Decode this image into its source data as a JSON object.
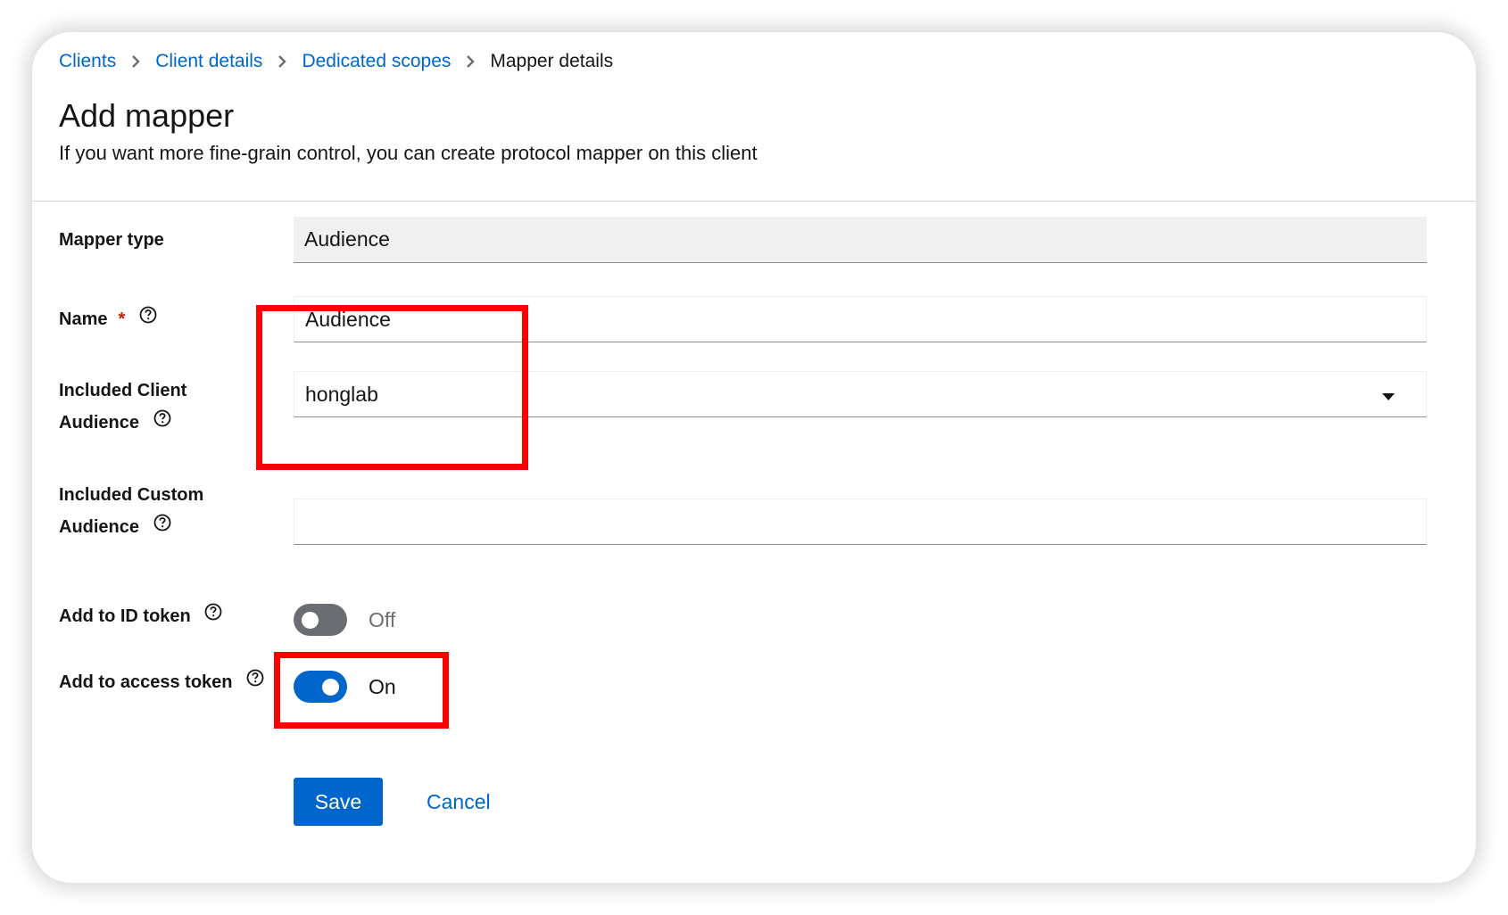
{
  "breadcrumb": {
    "items": [
      "Clients",
      "Client details",
      "Dedicated scopes"
    ],
    "current": "Mapper details"
  },
  "header": {
    "title": "Add mapper",
    "description": "If you want more fine-grain control, you can create protocol mapper on this client"
  },
  "form": {
    "mapper_type": {
      "label": "Mapper type",
      "value": "Audience"
    },
    "name": {
      "label": "Name",
      "required_mark": "*",
      "value": "Audience"
    },
    "included_client_audience": {
      "label_line1": "Included Client",
      "label_line2": "Audience",
      "value": "honglab"
    },
    "included_custom_audience": {
      "label_line1": "Included Custom",
      "label_line2": "Audience",
      "value": ""
    },
    "add_to_id_token": {
      "label": "Add to ID token",
      "state": "Off",
      "enabled": false
    },
    "add_to_access_token": {
      "label": "Add to access token",
      "state": "On",
      "enabled": true
    }
  },
  "actions": {
    "save_label": "Save",
    "cancel_label": "Cancel"
  },
  "icons": {
    "help": "help-circle-icon",
    "caret": "caret-down-icon",
    "separator": "chevron-right-icon"
  },
  "colors": {
    "link": "#0066cc",
    "primary": "#0066cc",
    "highlight": "#ff0000",
    "required": "#c9190b"
  }
}
